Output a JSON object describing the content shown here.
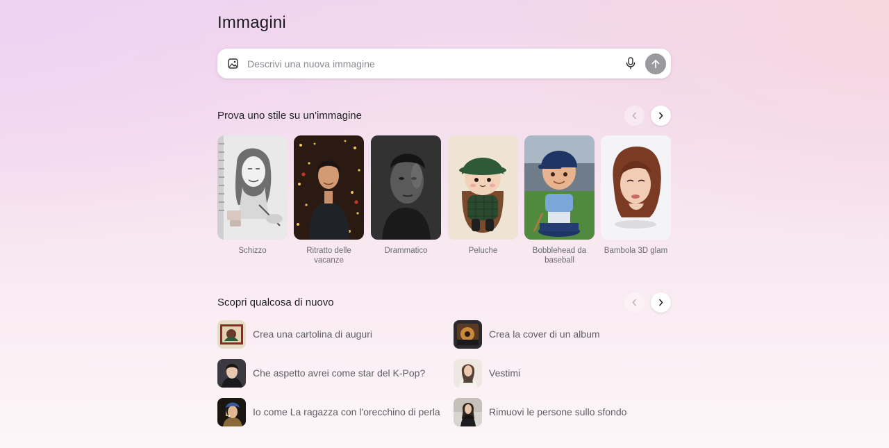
{
  "header": {
    "title": "Immagini"
  },
  "search": {
    "placeholder": "Descrivi una nuova immagine",
    "value": ""
  },
  "styles_section": {
    "title": "Prova uno stile su un'immagine",
    "items": [
      {
        "label": "Schizzo",
        "icon": "sketch-portrait-thumbnail"
      },
      {
        "label": "Ritratto delle vacanze",
        "icon": "holiday-portrait-thumbnail"
      },
      {
        "label": "Drammatico",
        "icon": "dramatic-portrait-thumbnail"
      },
      {
        "label": "Peluche",
        "icon": "plush-toy-thumbnail"
      },
      {
        "label": "Bobblehead da baseball",
        "icon": "baseball-bobblehead-thumbnail"
      },
      {
        "label": "Bambola 3D glam",
        "icon": "glam-3d-doll-thumbnail"
      }
    ]
  },
  "discover_section": {
    "title": "Scopri qualcosa di nuovo",
    "items": [
      {
        "label": "Crea una cartolina di auguri",
        "icon": "greeting-card-thumbnail"
      },
      {
        "label": "Crea la cover di un album",
        "icon": "album-cover-thumbnail"
      },
      {
        "label": "Che aspetto avrei come star del K-Pop?",
        "icon": "kpop-star-thumbnail"
      },
      {
        "label": "Vestimi",
        "icon": "dress-me-thumbnail"
      },
      {
        "label": "Io come La ragazza con l'orecchino di perla",
        "icon": "pearl-earring-thumbnail"
      },
      {
        "label": "Rimuovi le persone sullo sfondo",
        "icon": "remove-people-thumbnail"
      }
    ]
  },
  "colors": {
    "send_button": "#9b9b9f",
    "title_text": "#1b1b20",
    "muted_text": "#6a6a70"
  }
}
